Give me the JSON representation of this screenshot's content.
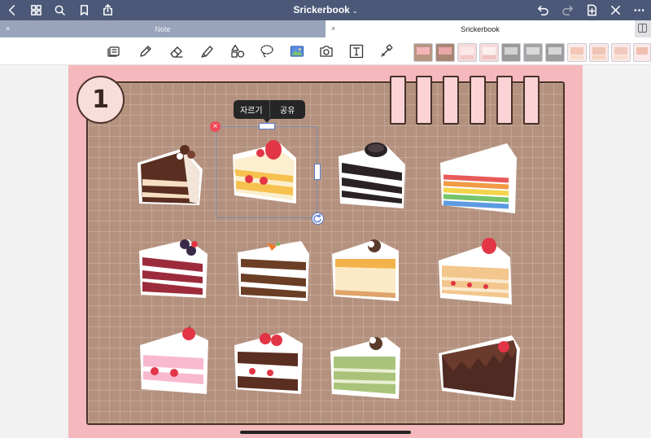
{
  "app": {
    "title": "Srickerbook",
    "title_caret": "⌄"
  },
  "nav": {
    "left_icons": [
      "back-chevron-icon",
      "grid-icon",
      "search-icon",
      "bookmark-icon",
      "share-icon"
    ],
    "right_icons": [
      "undo-icon",
      "redo-icon",
      "add-page-icon",
      "close-icon",
      "more-icon"
    ]
  },
  "tabs": [
    {
      "label": "Note",
      "state": "inactive",
      "close": "×"
    },
    {
      "label": "Srickerbook",
      "state": "active",
      "close": "×"
    }
  ],
  "toolbar": {
    "tools": [
      "page-layout-icon",
      "pen-icon",
      "eraser-icon",
      "highlighter-icon",
      "shapes-icon",
      "lasso-icon",
      "image-icon",
      "camera-icon",
      "text-icon",
      "laser-pointer-icon"
    ],
    "thumbnails_count": 12
  },
  "page": {
    "number": "1",
    "colors": {
      "page": "#f5b8bc",
      "board": "#b4917e",
      "border": "#4a3228",
      "tag": "#fbd3d6"
    }
  },
  "selection": {
    "delete_glyph": "×",
    "menu": {
      "crop_label": "자르기",
      "share_label": "공유"
    }
  },
  "stickers": [
    "chocolate-cake",
    "strawberry-shortcake",
    "oreo-cake",
    "rainbow-cake",
    "red-velvet-cake",
    "carrot-cake",
    "cheesecake",
    "crepe-cake",
    "pink-strawberry-cake",
    "strawberry-chocolate-cake",
    "matcha-crepe-cake",
    "chocolate-ganache-cake"
  ]
}
